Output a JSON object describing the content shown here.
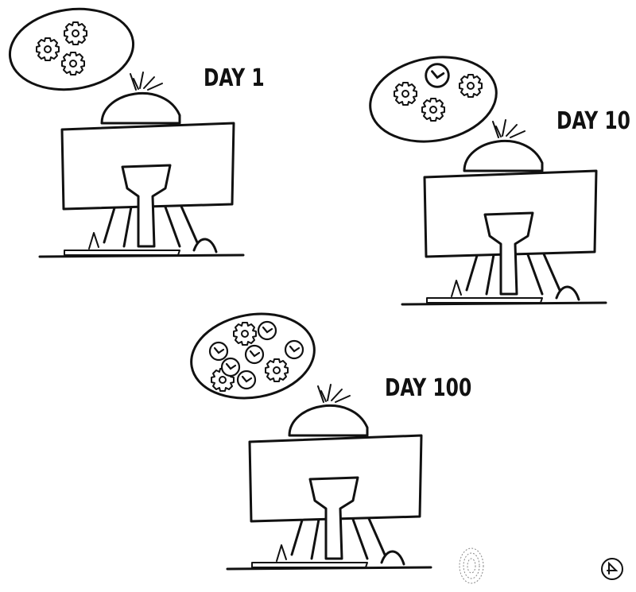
{
  "panels": [
    {
      "label": "DAY 1",
      "gears": 3,
      "clocks": 0
    },
    {
      "label": "DAY 10",
      "gears": 3,
      "clocks": 1
    },
    {
      "label": "DAY 100",
      "gears": 3,
      "clocks": 6
    }
  ],
  "colors": {
    "ink": "#111111",
    "paper": "#ffffff"
  },
  "icons": [
    "gear-icon",
    "clock-icon",
    "thumbprint-icon",
    "signature-icon"
  ]
}
